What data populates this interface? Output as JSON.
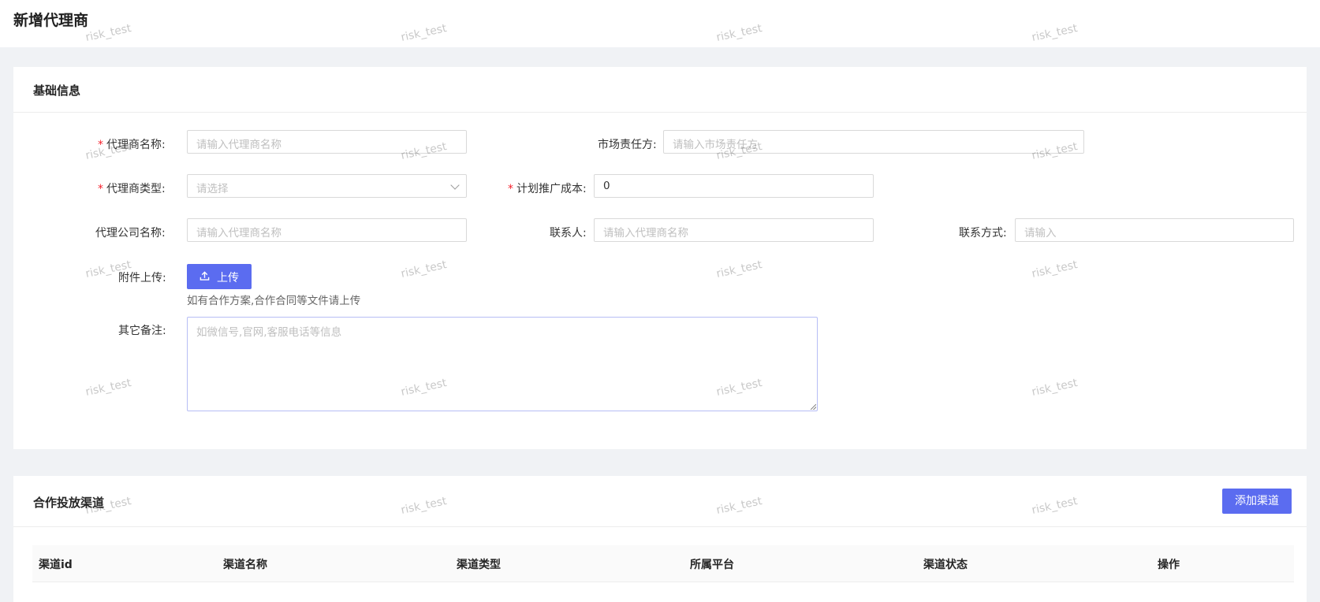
{
  "page": {
    "title": "新增代理商"
  },
  "basic_info": {
    "title": "基础信息",
    "fields": {
      "agent_name": {
        "label": "代理商名称:",
        "placeholder": "请输入代理商名称",
        "required": true
      },
      "market_owner": {
        "label": "市场责任方:",
        "placeholder": "请输入市场责任方",
        "required": false
      },
      "agent_type": {
        "label": "代理商类型:",
        "placeholder": "请选择",
        "required": true
      },
      "promo_cost": {
        "label": "计划推广成本:",
        "value": "0",
        "required": true
      },
      "company_name": {
        "label": "代理公司名称:",
        "placeholder": "请输入代理商名称"
      },
      "contact_person": {
        "label": "联系人:",
        "placeholder": "请输入代理商名称"
      },
      "contact_method": {
        "label": "联系方式:",
        "placeholder": "请输入"
      },
      "attachment": {
        "label": "附件上传:",
        "button": "上传",
        "hint": "如有合作方案,合作合同等文件请上传"
      },
      "remarks": {
        "label": "其它备注:",
        "placeholder": "如微信号,官网,客服电话等信息"
      }
    }
  },
  "channels": {
    "title": "合作投放渠道",
    "add_button": "添加渠道",
    "columns": [
      "渠道id",
      "渠道名称",
      "渠道类型",
      "所属平台",
      "渠道状态",
      "操作"
    ]
  },
  "watermark": "risk_test",
  "colors": {
    "primary": "#5b6cf0",
    "required": "#f5222d",
    "background": "#f0f2f5"
  }
}
